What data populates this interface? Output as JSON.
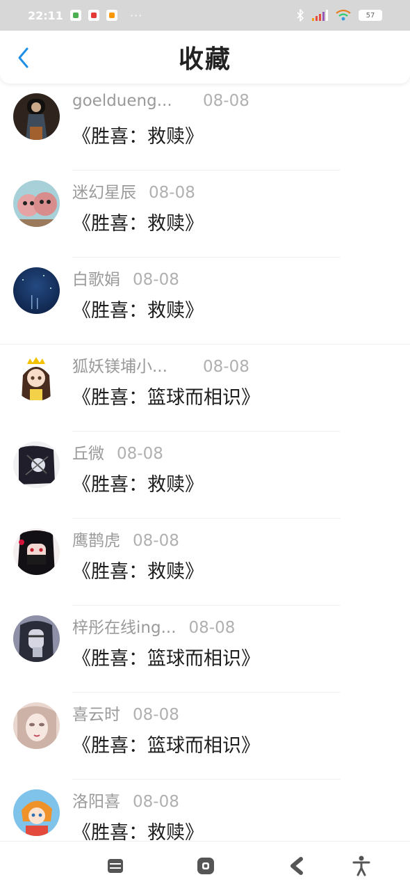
{
  "status": {
    "time": "22:11",
    "dots": "···",
    "battery": "57"
  },
  "header": {
    "title": "收藏"
  },
  "items": [
    {
      "name": "goeldueng...",
      "date": "08-08",
      "work": "《胜喜：救赎》"
    },
    {
      "name": "迷幻星辰",
      "date": "08-08",
      "work": "《胜喜：救赎》"
    },
    {
      "name": "白歌娟",
      "date": "08-08",
      "work": "《胜喜：救赎》"
    },
    {
      "name": "狐妖镁埔小...",
      "date": "08-08",
      "work": "《胜喜：篮球而相识》"
    },
    {
      "name": "丘微",
      "date": "08-08",
      "work": "《胜喜：救赎》"
    },
    {
      "name": "鹰鹊虎",
      "date": "08-08",
      "work": "《胜喜：救赎》"
    },
    {
      "name": "梓彤在线ing...",
      "date": "08-08",
      "work": "《胜喜：篮球而相识》"
    },
    {
      "name": "喜云时",
      "date": "08-08",
      "work": "《胜喜：篮球而相识》"
    },
    {
      "name": "洛阳喜",
      "date": "08-08",
      "work": "《胜喜：救赎》"
    }
  ],
  "colors": {
    "accent": "#1f8fe6",
    "status_bar": "#d7d7d7"
  }
}
